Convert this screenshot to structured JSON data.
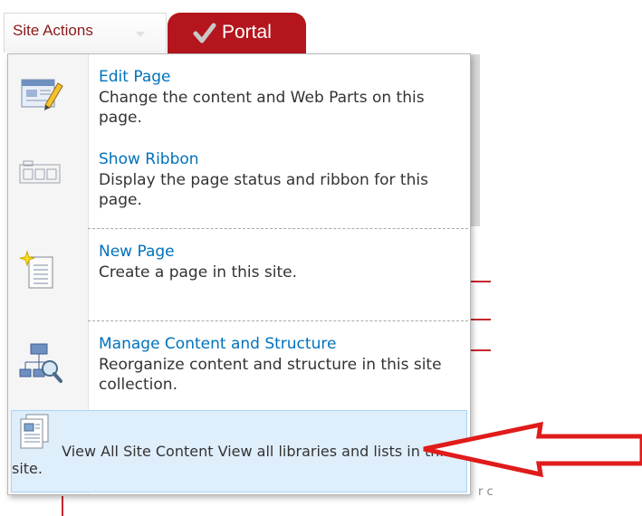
{
  "top_bar": {
    "site_actions_label": "Site Actions",
    "portal_tab_label": "Portal"
  },
  "menu": {
    "items": [
      {
        "icon": "edit-page-icon",
        "title": "Edit Page",
        "description": "Change the content and Web Parts on this page."
      },
      {
        "icon": "ribbon-icon",
        "title": "Show Ribbon",
        "description": "Display the page status and ribbon for this page."
      },
      {
        "icon": "new-page-icon",
        "title": "New Page",
        "description": "Create a page in this site."
      },
      {
        "icon": "site-structure-icon",
        "title": "Manage Content and Structure",
        "description": "Reorganize content and structure in this site collection."
      },
      {
        "icon": "view-all-content-icon",
        "title": "View All Site Content",
        "description": "View all libraries and lists in this site.",
        "highlighted": true
      }
    ]
  },
  "background": {
    "partial_text": "r c"
  },
  "colors": {
    "accent_red": "#b5161d",
    "link_blue": "#0072bc",
    "hover_bg": "#dfeefb",
    "annotation_arrow": "#e01b1b"
  }
}
